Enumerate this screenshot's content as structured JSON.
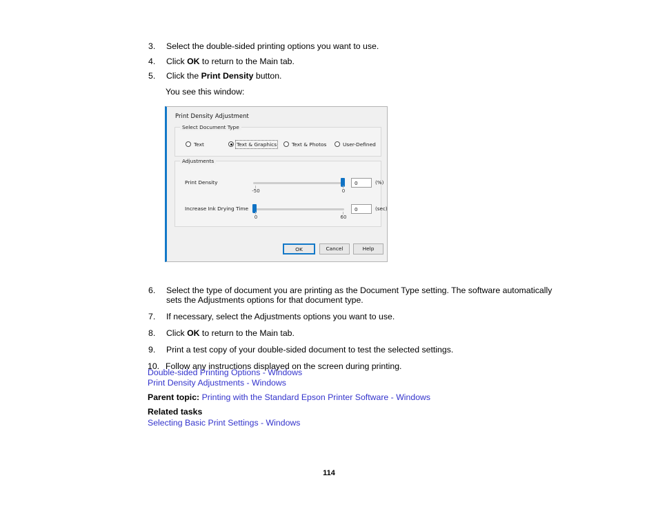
{
  "document": {
    "page_number": "114",
    "steps": [
      {
        "num": "3.",
        "text_parts": [
          {
            "t": "Select the double-sided printing options you want to use.",
            "bold": false
          }
        ]
      },
      {
        "num": "4.",
        "text_parts": [
          {
            "t": "Click ",
            "bold": false
          },
          {
            "t": "OK",
            "bold": true
          },
          {
            "t": " to return to the Main tab.",
            "bold": false
          }
        ]
      },
      {
        "num": "5.",
        "text_parts": [
          {
            "t": "Click the ",
            "bold": false
          },
          {
            "t": "Print Density",
            "bold": true
          },
          {
            "t": " button.",
            "bold": false
          }
        ]
      }
    ],
    "see_window_text": "You see this window:",
    "steps_after": [
      {
        "num": "6.",
        "text_parts": [
          {
            "t": "Select the type of document you are printing as the Document Type setting. The software automatically sets the Adjustments options for that document type.",
            "bold": false
          }
        ]
      },
      {
        "num": "7.",
        "text_parts": [
          {
            "t": "If necessary, select the Adjustments options you want to use.",
            "bold": false
          }
        ]
      },
      {
        "num": "8.",
        "text_parts": [
          {
            "t": "Click ",
            "bold": false
          },
          {
            "t": "OK",
            "bold": true
          },
          {
            "t": " to return to the Main tab.",
            "bold": false
          }
        ]
      },
      {
        "num": "9.",
        "text_parts": [
          {
            "t": "Print a test copy of your double-sided document to test the selected settings.",
            "bold": false
          }
        ]
      },
      {
        "num": "10.",
        "text_parts": [
          {
            "t": "Follow any instructions displayed on the screen during printing.",
            "bold": false
          }
        ]
      }
    ],
    "links": [
      "Double-sided Printing Options - Windows",
      "Print Density Adjustments - Windows"
    ],
    "parent_topic": {
      "label": "Parent topic:",
      "link": "Printing with the Standard Epson Printer Software - Windows"
    },
    "related_tasks": {
      "header": "Related tasks",
      "link": "Selecting Basic Print Settings - Windows"
    },
    "link_color": "#3333CC"
  },
  "dialog": {
    "title": "Print Density Adjustment",
    "accent_color": "#1278C8",
    "document_type_group": {
      "label": "Select Document Type",
      "options": [
        {
          "label": "Text",
          "selected": false
        },
        {
          "label": "Text & Graphics",
          "selected": true
        },
        {
          "label": "Text & Photos",
          "selected": false
        },
        {
          "label": "User-Defined",
          "selected": false
        }
      ]
    },
    "adjustments_group": {
      "label": "Adjustments",
      "sliders": [
        {
          "label": "Print Density",
          "value": "0",
          "unit": "(%)",
          "min_tick": "-50",
          "max_tick": "0",
          "thumb_percent": 100
        },
        {
          "label": "Increase Ink Drying Time",
          "value": "0",
          "unit": "(sec)",
          "min_tick": "0",
          "max_tick": "60",
          "thumb_percent": 0
        }
      ]
    },
    "buttons": [
      {
        "label": "OK",
        "primary": true
      },
      {
        "label": "Cancel",
        "primary": false
      },
      {
        "label": "Help",
        "primary": false
      }
    ]
  }
}
